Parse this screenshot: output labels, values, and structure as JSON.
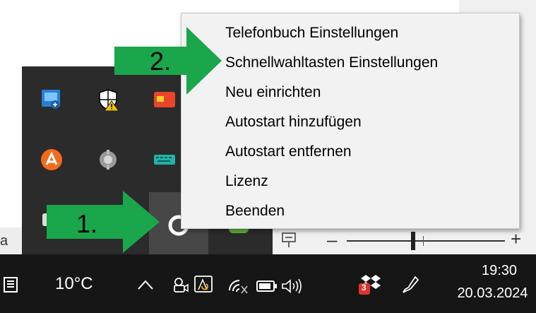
{
  "background": {
    "left_strip_text": "a"
  },
  "context_menu": {
    "items": [
      {
        "label": "Telefonbuch Einstellungen"
      },
      {
        "label": "Schnellwahltasten Einstellungen"
      },
      {
        "label": "Neu einrichten"
      },
      {
        "label": "Autostart hinzufügen"
      },
      {
        "label": "Autostart entfernen"
      },
      {
        "label": "Lizenz"
      },
      {
        "label": "Beenden"
      }
    ]
  },
  "annotations": {
    "step1": "1.",
    "step2": "2.",
    "arrow_color": "#1aa64b"
  },
  "status_bar": {
    "zoom_minus": "–",
    "zoom_plus": "+"
  },
  "taskbar": {
    "weather_temp": "10°C",
    "time": "19:30",
    "date": "20.03.2024",
    "dropbox_badge": "3"
  },
  "colors": {
    "taskbar_bg": "#161616",
    "tray_bg": "#2b2b2b",
    "menu_bg": "#f2f2f2"
  }
}
